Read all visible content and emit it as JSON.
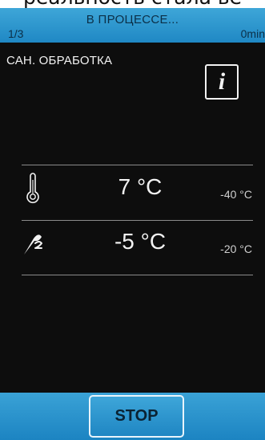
{
  "banner": {
    "text": "реальность стала ве"
  },
  "header": {
    "title": "В ПРОЦЕССЕ...",
    "step": "1/3",
    "elapsed": "0min"
  },
  "program": {
    "name": "САН. ОБРАБОТКА",
    "info_label": "i"
  },
  "readings": [
    {
      "icon": "thermometer-icon",
      "value": "7 °C",
      "target": "-40 °C"
    },
    {
      "icon": "core-probe-icon",
      "value": "-5 °C",
      "target": "-20 °C"
    }
  ],
  "footer": {
    "stop_label": "STOP"
  },
  "colors": {
    "header_blue": "#2a96cf",
    "screen_bg": "#0d0d0d",
    "text_light": "#f2f2f2",
    "divider": "#8a8a8a"
  }
}
